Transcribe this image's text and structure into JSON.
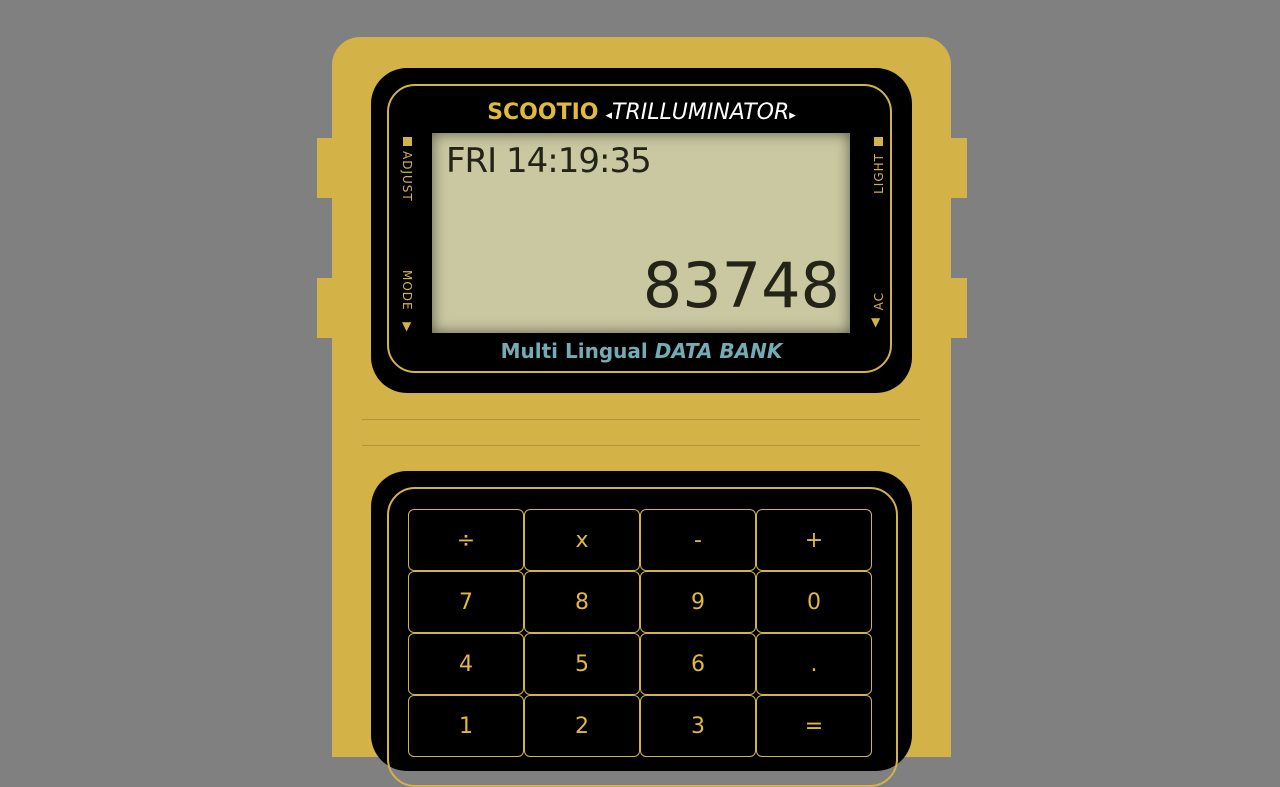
{
  "brand": {
    "maker": "SCOOTIO",
    "model": "TRILLUMINATOR"
  },
  "lcd": {
    "time": "FRI 14:19:35",
    "number": "83748"
  },
  "buttons": {
    "adjust": "ADJUST",
    "mode": "MODE",
    "light": "LIGHT",
    "ac": "AC"
  },
  "tagline": {
    "plain": "Multi Lingual",
    "emphasis": "DATA BANK"
  },
  "keypad": {
    "keys": [
      "÷",
      "x",
      "-",
      "+",
      "7",
      "8",
      "9",
      "0",
      "4",
      "5",
      "6",
      ".",
      "1",
      "2",
      "3",
      "="
    ]
  },
  "colors": {
    "case": "#d3b247",
    "lcd": "#c9c8a1",
    "accent_text": "#e1b93c",
    "tagline": "#73acb5",
    "background": "#808080"
  }
}
